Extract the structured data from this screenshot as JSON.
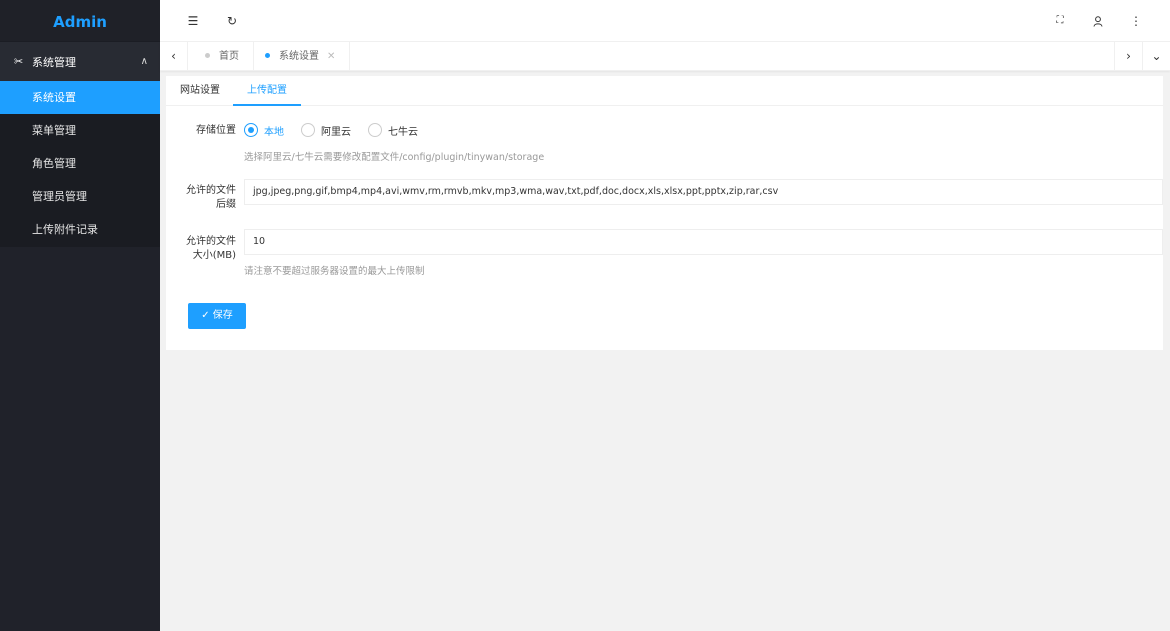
{
  "sidebar": {
    "logo": "Admin",
    "group": {
      "icon": "tools-icon",
      "label": "系统管理",
      "expanded": true
    },
    "items": [
      {
        "label": "系统设置",
        "active": true
      },
      {
        "label": "菜单管理",
        "active": false
      },
      {
        "label": "角色管理",
        "active": false
      },
      {
        "label": "管理员管理",
        "active": false
      },
      {
        "label": "上传附件记录",
        "active": false
      }
    ]
  },
  "header": {
    "left_icons": [
      "menu-collapse-icon",
      "refresh-icon"
    ],
    "right_icons": [
      "fullscreen-icon",
      "user-icon",
      "more-vertical-icon"
    ]
  },
  "tabs": [
    {
      "label": "首页",
      "active": false,
      "closable": false
    },
    {
      "label": "系统设置",
      "active": true,
      "closable": true
    }
  ],
  "content": {
    "tabs": [
      {
        "label": "网站设置",
        "active": false
      },
      {
        "label": "上传配置",
        "active": true
      }
    ],
    "form": {
      "storage": {
        "label": "存储位置",
        "options": [
          {
            "label": "本地",
            "checked": true
          },
          {
            "label": "阿里云",
            "checked": false
          },
          {
            "label": "七牛云",
            "checked": false
          }
        ],
        "hint": "选择阿里云/七牛云需要修改配置文件/config/plugin/tinywan/storage"
      },
      "extensions": {
        "label_line1": "允许的文件",
        "label_line2": "后缀",
        "value": "jpg,jpeg,png,gif,bmp4,mp4,avi,wmv,rm,rmvb,mkv,mp3,wma,wav,txt,pdf,doc,docx,xls,xlsx,ppt,pptx,zip,rar,csv"
      },
      "max_size": {
        "label_line1": "允许的文件",
        "label_line2": "大小(MB)",
        "value": "10",
        "hint": "请注意不要超过服务器设置的最大上传限制"
      },
      "save_label": "保存"
    }
  },
  "colors": {
    "accent": "#1e9fff",
    "sidebar_bg": "#20222a"
  }
}
